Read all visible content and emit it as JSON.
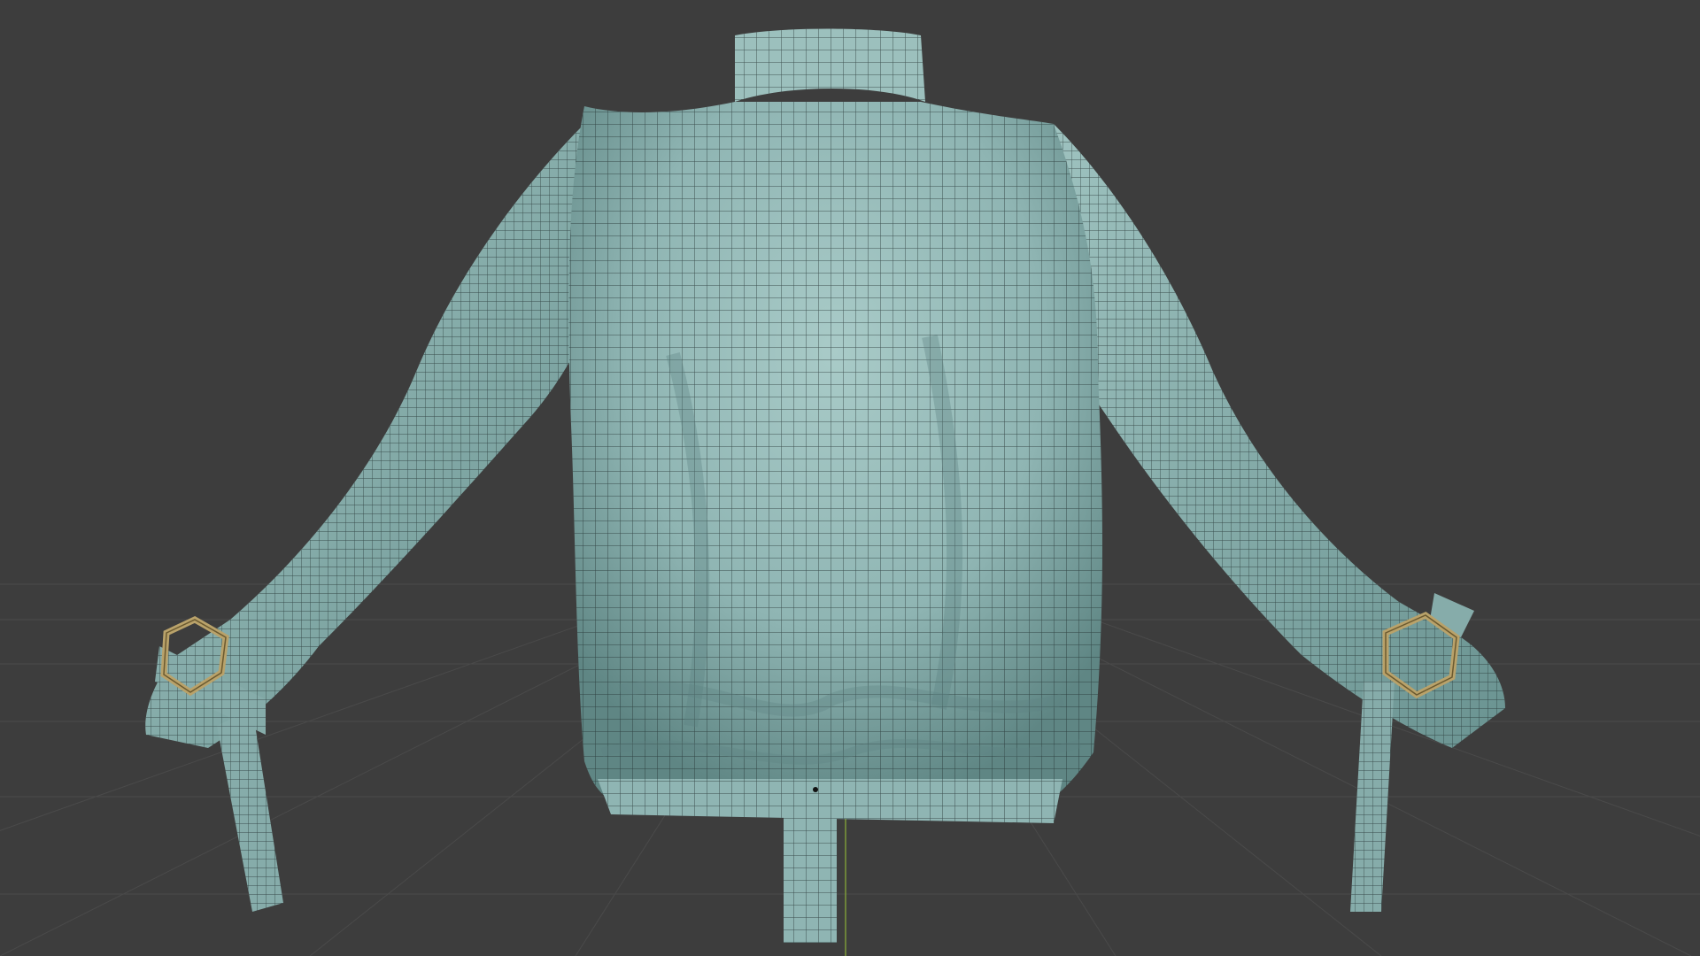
{
  "app": {
    "type": "3d-viewport",
    "view": "perspective",
    "grid_floor": true,
    "overlay_wireframe": true
  },
  "colors": {
    "background": "#3d3d3d",
    "grid_line": "#4a4a4a",
    "axis_y": "#7d9a3a",
    "mesh_fill": "#8fb5b3",
    "mesh_shade": "#6f9896",
    "mesh_highlight": "#a9cbc8",
    "wire": "#1f2d2d",
    "buckle": "#b9a26a"
  },
  "object": {
    "name": "",
    "description_icon": "garment-mesh-icon"
  }
}
